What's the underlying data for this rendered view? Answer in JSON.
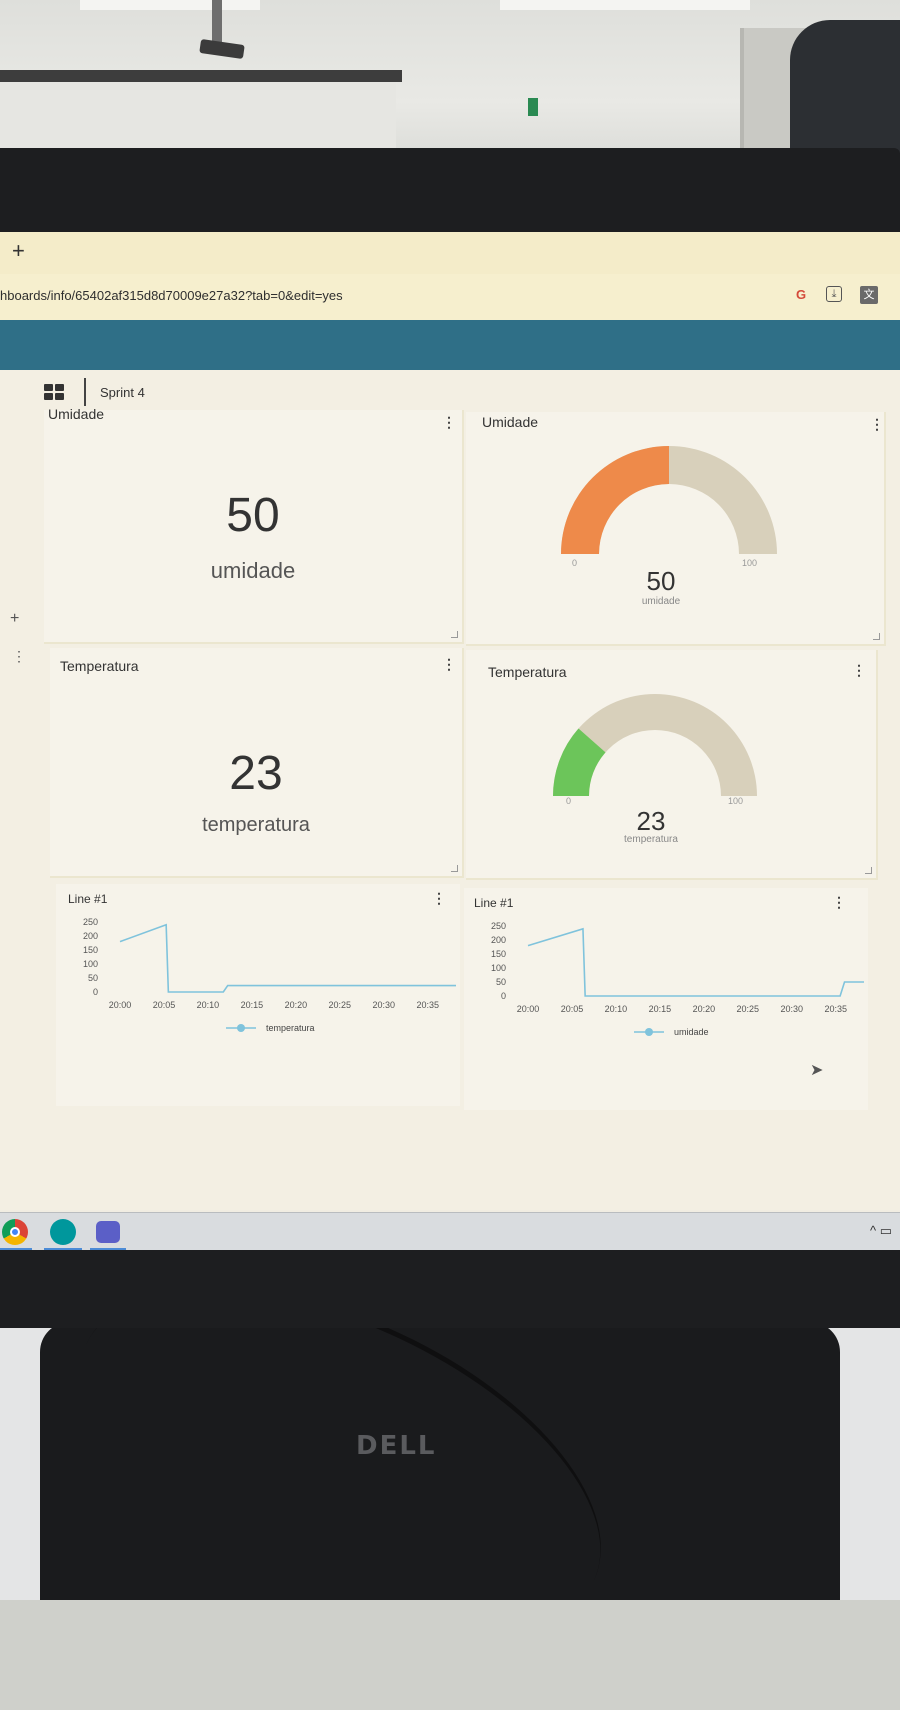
{
  "browser": {
    "new_tab_icon": "+",
    "url": "hboards/info/65402af315d8d70009e27a32?tab=0&edit=yes",
    "extensions": [
      "G",
      "⤓",
      "文"
    ]
  },
  "toolbar": {
    "dashboard_title": "Sprint 4"
  },
  "widgets": {
    "umidade_value": {
      "title": "Umidade",
      "value": "50",
      "unit": "umidade"
    },
    "umidade_gauge": {
      "title": "Umidade",
      "value": 50,
      "min": "0",
      "max": "100",
      "value_label": "50",
      "unit": "umidade",
      "color": "#ee8a4a"
    },
    "temp_value": {
      "title": "Temperatura",
      "value": "23",
      "unit": "temperatura"
    },
    "temp_gauge": {
      "title": "Temperatura",
      "value": 23,
      "min": "0",
      "max": "100",
      "value_label": "23",
      "unit": "temperatura",
      "color": "#6cc55a"
    },
    "line_temp": {
      "title": "Line #1",
      "legend": "temperatura"
    },
    "line_umid": {
      "title": "Line #1",
      "legend": "umidade"
    }
  },
  "chart_data": [
    {
      "type": "line",
      "title": "Line #1",
      "x": [
        "20:00",
        "20:05",
        "20:10",
        "20:15",
        "20:20",
        "20:25",
        "20:30",
        "20:35"
      ],
      "yticks": [
        0,
        50,
        100,
        150,
        200,
        250
      ],
      "ylim": [
        0,
        250
      ],
      "series": [
        {
          "name": "temperatura",
          "color": "#7fc3dc",
          "points": [
            [
              0,
              180
            ],
            [
              1.05,
              240
            ],
            [
              1.1,
              0
            ],
            [
              2.35,
              0
            ],
            [
              2.45,
              23
            ],
            [
              8,
              23
            ]
          ]
        }
      ],
      "legend": "bottom",
      "grid": false
    },
    {
      "type": "line",
      "title": "Line #1",
      "x": [
        "20:00",
        "20:05",
        "20:10",
        "20:15",
        "20:20",
        "20:25",
        "20:30",
        "20:35"
      ],
      "yticks": [
        0,
        50,
        100,
        150,
        200,
        250
      ],
      "ylim": [
        0,
        250
      ],
      "series": [
        {
          "name": "umidade",
          "color": "#7fc3dc",
          "points": [
            [
              0,
              180
            ],
            [
              1.25,
              240
            ],
            [
              1.3,
              0
            ],
            [
              7.1,
              0
            ],
            [
              7.2,
              50
            ],
            [
              8,
              50
            ]
          ]
        }
      ],
      "legend": "bottom",
      "grid": false
    }
  ],
  "taskbar": {
    "apps": [
      "chrome-icon",
      "arduino-icon",
      "teams-icon"
    ],
    "tray": "^ ▭"
  },
  "monitor": {
    "brand": "DELL"
  }
}
